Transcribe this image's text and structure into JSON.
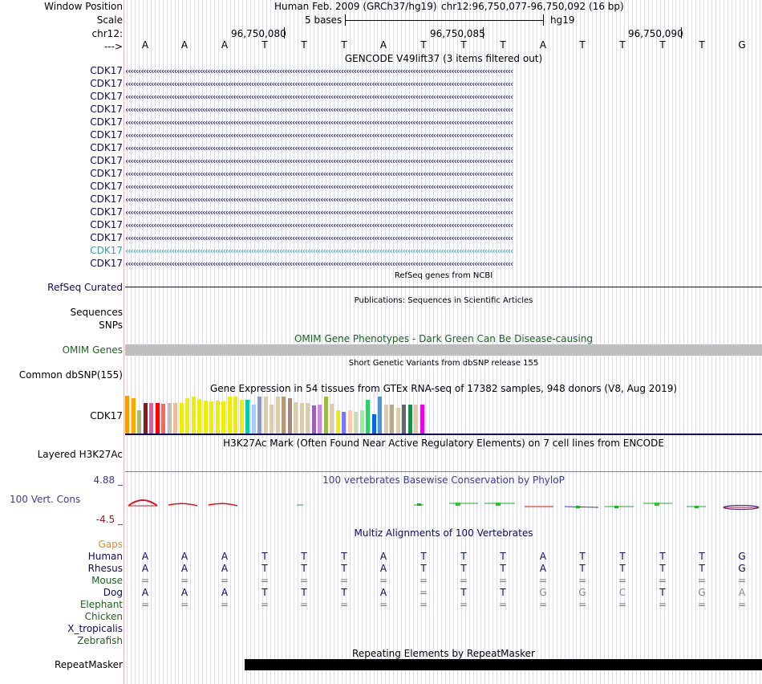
{
  "header": {
    "window_position_label": "Window Position",
    "scale_label": "Scale",
    "chrom_label": "chr12:",
    "strand_label": "--->",
    "assembly": "Human Feb. 2009 (GRCh37/hg19)",
    "position": "chr12:96,750,077-96,750,092 (16 bp)",
    "scale_text": "5 bases",
    "db": "hg19",
    "coords": [
      "96,750,080",
      "96,750,085",
      "96,750,090"
    ],
    "bases": [
      "A",
      "A",
      "A",
      "T",
      "T",
      "T",
      "A",
      "T",
      "T",
      "T",
      "A",
      "T",
      "T",
      "T",
      "T",
      "G"
    ]
  },
  "gencode": {
    "title": "GENCODE V49lift37 (3 items filtered out)",
    "genes": [
      "CDK17",
      "CDK17",
      "CDK17",
      "CDK17",
      "CDK17",
      "CDK17",
      "CDK17",
      "CDK17",
      "CDK17",
      "CDK17",
      "CDK17",
      "CDK17",
      "CDK17",
      "CDK17",
      "CDK17",
      "CDK17"
    ],
    "arrows": "‹‹‹‹‹‹‹‹‹‹‹‹‹‹‹‹‹‹‹‹‹‹‹‹‹‹‹‹‹‹‹‹‹‹‹‹‹‹‹‹‹‹‹‹‹‹‹‹‹‹‹‹‹‹‹‹‹‹‹‹‹‹‹‹‹‹‹‹‹‹‹‹‹‹‹‹‹‹‹‹‹‹‹‹‹‹‹‹‹‹‹‹‹‹‹‹‹‹‹‹‹‹‹‹‹‹‹‹‹‹‹‹‹‹‹‹‹‹‹‹‹‹‹‹‹‹‹‹‹‹‹‹‹‹‹‹‹‹‹‹‹‹‹‹‹‹‹‹‹‹‹"
  },
  "refseq": {
    "label": "RefSeq Curated",
    "title": "RefSeq genes from NCBI"
  },
  "publications": {
    "title": "Publications: Sequences in Scientific Articles",
    "sequences_label": "Sequences",
    "snps_label": "SNPs"
  },
  "omim": {
    "title": "OMIM Gene Phenotypes - Dark Green Can Be Disease-causing",
    "label": "OMIM Genes"
  },
  "dbsnp": {
    "title": "Short Genetic Variants from dbSNP release 155",
    "label": "Common dbSNP(155)"
  },
  "gtex": {
    "title": "Gene Expression in 54 tissues from GTEx RNA-seq of 17382 samples, 948 donors (V8, Aug 2019)",
    "label": "CDK17",
    "levels": [
      0.98,
      0.92,
      0.6,
      0.8,
      0.8,
      0.8,
      0.78,
      0.8,
      0.8,
      0.8,
      0.92,
      0.96,
      0.9,
      0.86,
      0.84,
      0.86,
      0.84,
      0.96,
      0.96,
      0.88,
      0.88,
      0.76,
      0.96,
      0.96,
      0.76,
      0.96,
      0.96,
      0.92,
      0.82,
      0.8,
      0.8,
      0.72,
      0.74,
      0.96,
      0.78,
      0.6,
      0.56,
      0.6,
      0.56,
      0.6,
      0.88,
      0.5,
      0.96,
      0.76,
      0.76,
      0.66,
      0.76,
      0.76,
      0.76,
      0.76,
      0.72,
      0.8,
      0.86,
      0.42
    ],
    "colors": [
      "#ff9900",
      "#ffaa00",
      "#aabb66",
      "#8b1a1a",
      "#cc6699",
      "#ff0000",
      "#ff6655",
      "#ccbbaa",
      "#eebb99",
      "#eeee00",
      "#eeee00",
      "#eeee00",
      "#eeee00",
      "#eeee00",
      "#eeee00",
      "#eeee00",
      "#eeee00",
      "#eeee00",
      "#eeee00",
      "#eeee00",
      "#00ccaa",
      "#aaccff",
      "#8899cc",
      "#ddccaa",
      "#ddccaa",
      "#ddccaa",
      "#bb9966",
      "#aa8877",
      "#ddccaa",
      "#ddccaa",
      "#ddccaa",
      "#aa55cc",
      "#cc88dd",
      "#99bb44",
      "#ddccaa",
      "#eeee00",
      "#7777ff",
      "#ffccaa",
      "#ccddaa",
      "#99ee99",
      "#33cc66",
      "#0066ee",
      "#4499dd",
      "#ddccaa",
      "#bbaa88",
      "#ddccaa",
      "#666666",
      "#009944",
      "#ddccaa",
      "#ee00ee"
    ]
  },
  "h3k27ac": {
    "title": "H3K27Ac Mark (Often Found Near Active Regulatory Elements) on 7 cell lines from ENCODE",
    "label": "Layered H3K27Ac"
  },
  "phylop": {
    "title": "100 vertebrates Basewise Conservation by PhyloP",
    "label": "100 Vert. Cons",
    "max": "4.88 _",
    "min": "-4.5 _"
  },
  "multiz": {
    "title": "Multiz Alignments of 100 Vertebrates",
    "gaps_label": "Gaps",
    "species": [
      {
        "name": "Human",
        "color": "#0a0a64",
        "bases": [
          "A",
          "A",
          "A",
          "T",
          "T",
          "T",
          "A",
          "T",
          "T",
          "T",
          "A",
          "T",
          "T",
          "T",
          "T",
          "G"
        ]
      },
      {
        "name": "Rhesus",
        "color": "#0a0a64",
        "bases": [
          "A",
          "A",
          "A",
          "T",
          "T",
          "T",
          "A",
          "T",
          "T",
          "T",
          "A",
          "T",
          "T",
          "T",
          "T",
          "G"
        ]
      },
      {
        "name": "Mouse",
        "color": "#1a641a",
        "bases": [
          "=",
          "=",
          "=",
          "=",
          "=",
          "=",
          "=",
          "=",
          "=",
          "=",
          "=",
          "=",
          "=",
          "=",
          "=",
          "="
        ]
      },
      {
        "name": "Dog",
        "color": "#0a0a64",
        "bases": [
          "A",
          "A",
          "A",
          "T",
          "T",
          "T",
          "A",
          "=",
          "T",
          "T",
          "G",
          "G",
          "C",
          "T",
          "G",
          "A"
        ]
      },
      {
        "name": "Elephant",
        "color": "#1a641a",
        "bases": [
          "=",
          "=",
          "=",
          "=",
          "=",
          "=",
          "=",
          "=",
          "=",
          "=",
          "=",
          "=",
          "=",
          "=",
          "=",
          "="
        ]
      },
      {
        "name": "Chicken",
        "color": "#1a641a",
        "bases": []
      },
      {
        "name": "X_tropicalis",
        "color": "#0a0a64",
        "bases": []
      },
      {
        "name": "Zebrafish",
        "color": "#1a641a",
        "bases": []
      }
    ]
  },
  "repeatmasker": {
    "title": "Repeating Elements by RepeatMasker",
    "label": "RepeatMasker"
  }
}
